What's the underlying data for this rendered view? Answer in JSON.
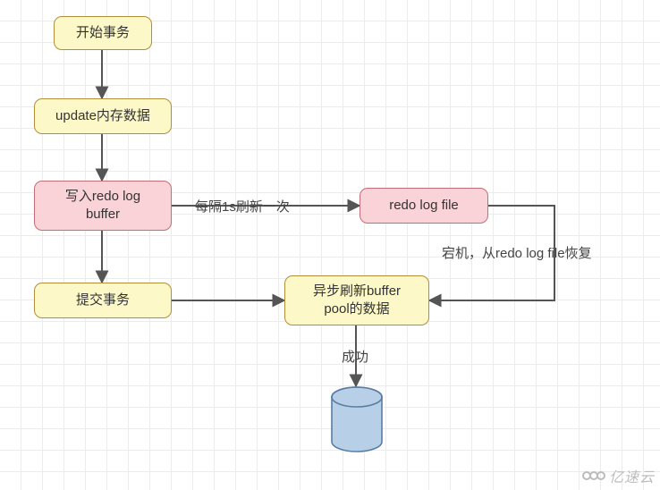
{
  "nodes": {
    "start": {
      "label": "开始事务"
    },
    "update": {
      "label": "update内存数据"
    },
    "redo_buffer": {
      "label": "写入redo log\nbuffer"
    },
    "commit": {
      "label": "提交事务"
    },
    "redo_file": {
      "label": "redo log file"
    },
    "async_flush": {
      "label": "异步刷新buffer\npool的数据"
    }
  },
  "edges": {
    "refresh_1s": {
      "label": "每隔1s刷新一次"
    },
    "crash_recover": {
      "label": "宕机，从redo log file恢复"
    },
    "success": {
      "label": "成功"
    }
  },
  "watermark": {
    "text": "亿速云"
  },
  "chart_data": {
    "type": "flowchart",
    "title": "",
    "nodes": [
      {
        "id": "start",
        "label": "开始事务",
        "shape": "rounded-rect",
        "fill": "yellow"
      },
      {
        "id": "update",
        "label": "update内存数据",
        "shape": "rounded-rect",
        "fill": "yellow"
      },
      {
        "id": "redo_buffer",
        "label": "写入redo log buffer",
        "shape": "rounded-rect",
        "fill": "pink"
      },
      {
        "id": "commit",
        "label": "提交事务",
        "shape": "rounded-rect",
        "fill": "yellow"
      },
      {
        "id": "redo_file",
        "label": "redo log file",
        "shape": "rounded-rect",
        "fill": "pink"
      },
      {
        "id": "async_flush",
        "label": "异步刷新buffer pool的数据",
        "shape": "rounded-rect",
        "fill": "yellow"
      },
      {
        "id": "db",
        "label": "",
        "shape": "cylinder",
        "fill": "blue"
      }
    ],
    "edges": [
      {
        "from": "start",
        "to": "update",
        "label": ""
      },
      {
        "from": "update",
        "to": "redo_buffer",
        "label": ""
      },
      {
        "from": "redo_buffer",
        "to": "commit",
        "label": ""
      },
      {
        "from": "redo_buffer",
        "to": "redo_file",
        "label": "每隔1s刷新一次"
      },
      {
        "from": "commit",
        "to": "async_flush",
        "label": ""
      },
      {
        "from": "async_flush",
        "to": "db",
        "label": "成功"
      },
      {
        "from": "redo_file",
        "to": "async_flush",
        "label": "宕机，从redo log file恢复",
        "routing": "right-down-left"
      }
    ]
  }
}
